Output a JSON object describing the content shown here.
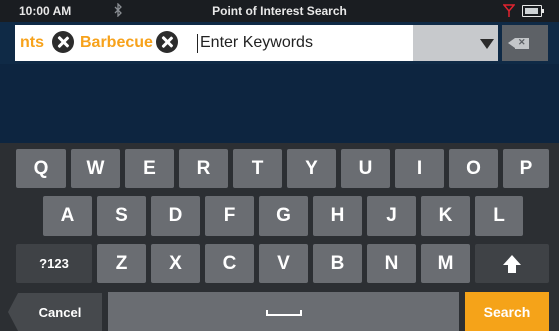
{
  "status_bar": {
    "time": "10:00 AM",
    "title": "Point of Interest Search",
    "icons": [
      "bluetooth-icon",
      "signal-icon",
      "battery-icon"
    ]
  },
  "search": {
    "chips": [
      {
        "label": "nts"
      },
      {
        "label": "Barbecue"
      }
    ],
    "placeholder": "Enter Keywords",
    "value": ""
  },
  "keyboard": {
    "row1": [
      "Q",
      "W",
      "E",
      "R",
      "T",
      "Y",
      "U",
      "I",
      "O",
      "P"
    ],
    "row2": [
      "A",
      "S",
      "D",
      "F",
      "G",
      "H",
      "J",
      "K",
      "L"
    ],
    "row3_special": "?123",
    "row3": [
      "Z",
      "X",
      "C",
      "V",
      "B",
      "N",
      "M"
    ],
    "cancel_label": "Cancel",
    "search_label": "Search"
  },
  "colors": {
    "accent": "#f5a319",
    "background": "#0d2540",
    "key": "#6a6d72",
    "keyboard_bg": "#2c2f33"
  }
}
